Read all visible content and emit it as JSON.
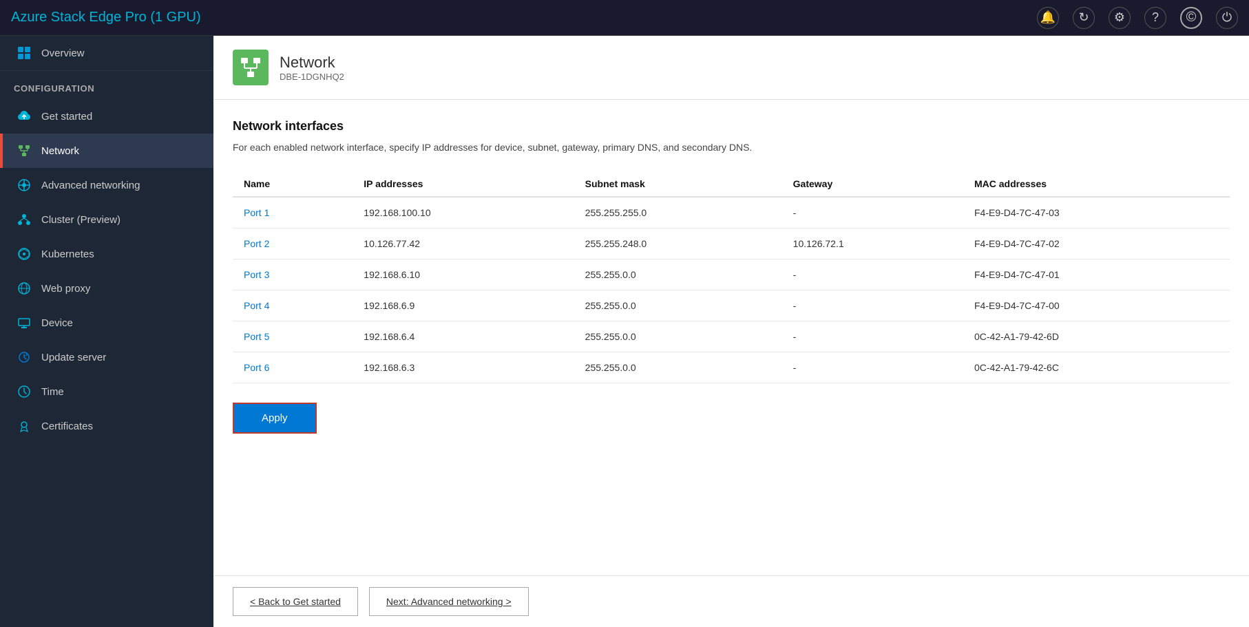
{
  "app": {
    "title": "Azure Stack Edge Pro (1 GPU)",
    "title_color": "#00b4d8"
  },
  "titlebar": {
    "icons": [
      "bell",
      "refresh",
      "settings",
      "help",
      "account",
      "power"
    ]
  },
  "sidebar": {
    "section_label": "CONFIGURATION",
    "items": [
      {
        "id": "overview",
        "label": "Overview",
        "icon": "grid",
        "active": false
      },
      {
        "id": "get-started",
        "label": "Get started",
        "icon": "cloud-upload",
        "active": false
      },
      {
        "id": "network",
        "label": "Network",
        "icon": "network",
        "active": true
      },
      {
        "id": "advanced-networking",
        "label": "Advanced networking",
        "icon": "advanced-network",
        "active": false
      },
      {
        "id": "cluster-preview",
        "label": "Cluster (Preview)",
        "icon": "cluster",
        "active": false
      },
      {
        "id": "kubernetes",
        "label": "Kubernetes",
        "icon": "kubernetes",
        "active": false
      },
      {
        "id": "web-proxy",
        "label": "Web proxy",
        "icon": "web",
        "active": false
      },
      {
        "id": "device",
        "label": "Device",
        "icon": "device",
        "active": false
      },
      {
        "id": "update-server",
        "label": "Update server",
        "icon": "update",
        "active": false
      },
      {
        "id": "time",
        "label": "Time",
        "icon": "time",
        "active": false
      },
      {
        "id": "certificates",
        "label": "Certificates",
        "icon": "certificates",
        "active": false
      }
    ]
  },
  "page": {
    "header_title": "Network",
    "header_subtitle": "DBE-1DGNHQ2",
    "section_title": "Network interfaces",
    "section_desc": "For each enabled network interface, specify IP addresses for device, subnet, gateway, primary DNS, and secondary DNS.",
    "table": {
      "columns": [
        "Name",
        "IP addresses",
        "Subnet mask",
        "Gateway",
        "MAC addresses"
      ],
      "rows": [
        {
          "name": "Port 1",
          "ip": "192.168.100.10",
          "subnet": "255.255.255.0",
          "gateway": "-",
          "mac": "F4-E9-D4-7C-47-03"
        },
        {
          "name": "Port 2",
          "ip": "10.126.77.42",
          "subnet": "255.255.248.0",
          "gateway": "10.126.72.1",
          "mac": "F4-E9-D4-7C-47-02"
        },
        {
          "name": "Port 3",
          "ip": "192.168.6.10",
          "subnet": "255.255.0.0",
          "gateway": "-",
          "mac": "F4-E9-D4-7C-47-01"
        },
        {
          "name": "Port 4",
          "ip": "192.168.6.9",
          "subnet": "255.255.0.0",
          "gateway": "-",
          "mac": "F4-E9-D4-7C-47-00"
        },
        {
          "name": "Port 5",
          "ip": "192.168.6.4",
          "subnet": "255.255.0.0",
          "gateway": "-",
          "mac": "0C-42-A1-79-42-6D"
        },
        {
          "name": "Port 6",
          "ip": "192.168.6.3",
          "subnet": "255.255.0.0",
          "gateway": "-",
          "mac": "0C-42-A1-79-42-6C"
        }
      ]
    },
    "apply_button": "Apply",
    "footer": {
      "back_label": "< Back to Get started",
      "next_label": "Next: Advanced networking >"
    }
  }
}
